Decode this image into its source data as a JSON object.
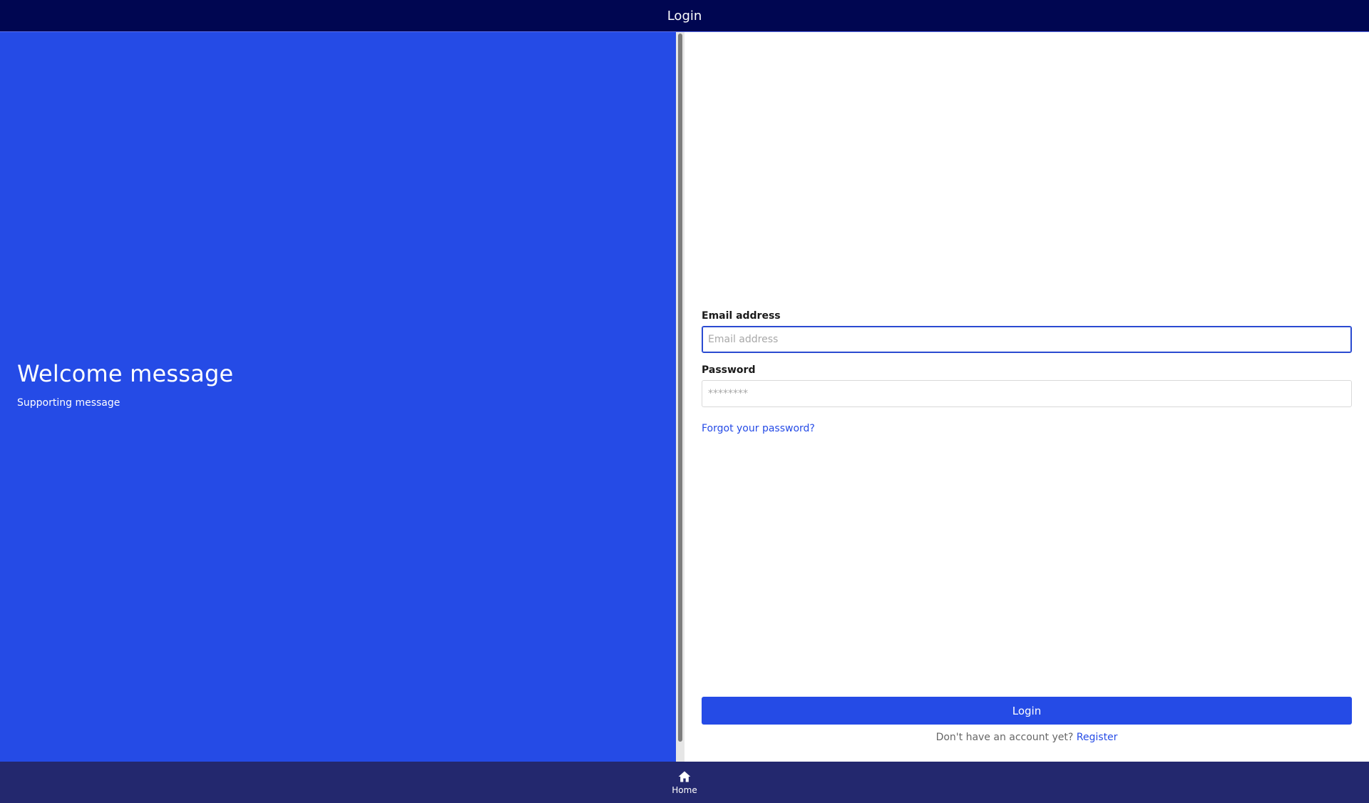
{
  "header": {
    "title": "Login"
  },
  "hero": {
    "title": "Welcome message",
    "subtitle": "Supporting message"
  },
  "form": {
    "email": {
      "label": "Email address",
      "placeholder": "Email address",
      "value": ""
    },
    "password": {
      "label": "Password",
      "placeholder": "********",
      "value": ""
    },
    "forgot_label": "Forgot your password?",
    "submit_label": "Login",
    "register_prompt": "Don't have an account yet?",
    "register_label": "Register"
  },
  "bottom_nav": {
    "items": [
      {
        "label": "Home",
        "icon": "home-icon"
      }
    ]
  },
  "colors": {
    "header_bg": "#000651",
    "hero_bg": "#254be6",
    "accent": "#254be6",
    "bottom_nav_bg": "#23286e"
  }
}
